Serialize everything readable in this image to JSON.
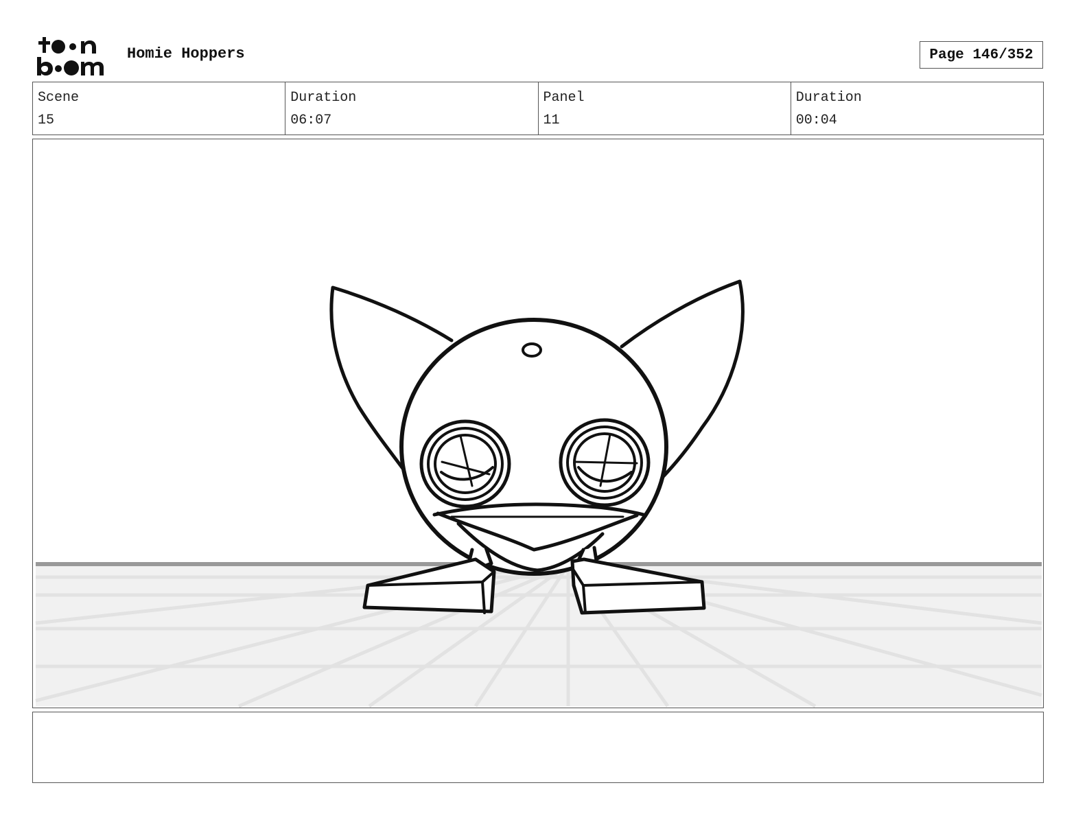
{
  "header": {
    "logo": "Toon Boom",
    "project_title": "Homie Hoppers",
    "page_label": "Page 146/352"
  },
  "info": {
    "scene_label": "Scene",
    "scene_value": "15",
    "scene_duration_label": "Duration",
    "scene_duration_value": "06:07",
    "panel_label": "Panel",
    "panel_value": "11",
    "panel_duration_label": "Duration",
    "panel_duration_value": "00:04"
  },
  "panel": {
    "subject": "robot-character-drawing"
  },
  "notes": {
    "text": ""
  }
}
